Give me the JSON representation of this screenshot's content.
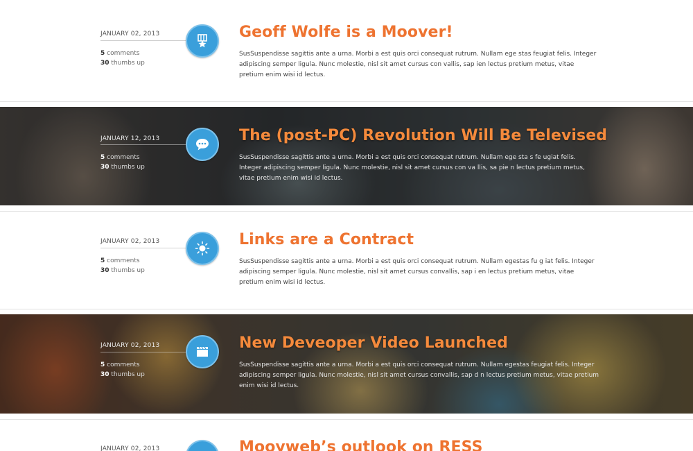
{
  "posts": [
    {
      "date": "JANUARY 02, 2013",
      "comments_count": "5",
      "comments_label": "comments",
      "thumbs_count": "30",
      "thumbs_label": "thumbs up",
      "icon": "badge-star-icon",
      "title": "Geoff Wolfe is a Moover!",
      "excerpt": "SusSuspendisse sagittis ante a urna. Morbi a est quis orci consequat rutrum. Nullam ege stas feugiat felis. Integer adipiscing semper ligula. Nunc molestie, nisl sit amet cursus con vallis, sap ien lectus pretium metus, vitae pretium enim wisi id lectus."
    },
    {
      "date": "JANUARY 12, 2013",
      "comments_count": "5",
      "comments_label": "comments",
      "thumbs_count": "30",
      "thumbs_label": "thumbs up",
      "icon": "speech-bubble-icon",
      "title": "The (post-PC) Revolution Will Be Televised",
      "excerpt": "SusSuspendisse sagittis ante a urna. Morbi a est quis orci consequat rutrum. Nullam ege sta s fe ugiat felis. Integer adipiscing semper ligula. Nunc molestie, nisl sit amet cursus con va llis, sa pie n lectus pretium metus, vitae pretium enim wisi id lectus."
    },
    {
      "date": "JANUARY 02, 2013",
      "comments_count": "5",
      "comments_label": "comments",
      "thumbs_count": "30",
      "thumbs_label": "thumbs up",
      "icon": "lightbulb-icon",
      "title": "Links are a Contract",
      "excerpt": "SusSuspendisse sagittis ante a urna. Morbi a est quis orci consequat rutrum. Nullam egestas fu g iat felis. Integer adipiscing semper ligula. Nunc molestie, nisl sit amet cursus convallis, sap i en lectus pretium metus, vitae pretium enim wisi id lectus."
    },
    {
      "date": "JANUARY 02, 2013",
      "comments_count": "5",
      "comments_label": "comments",
      "thumbs_count": "30",
      "thumbs_label": "thumbs up",
      "icon": "clapperboard-icon",
      "title": "New Deveoper Video Launched",
      "excerpt": "SusSuspendisse sagittis ante a urna. Morbi a est quis orci consequat rutrum. Nullam egestas feugiat felis. Integer adipiscing semper ligula. Nunc molestie, nisl sit amet cursus convallis, sap d n lectus pretium metus, vitae pretium enim wisi id lectus."
    },
    {
      "date": "JANUARY 02, 2013",
      "icon": "lightbulb-icon",
      "title": "Mooyweb’s outlook on RESS"
    }
  ],
  "colors": {
    "title_orange": "#ee7330",
    "icon_blue": "#3a9fdb"
  }
}
